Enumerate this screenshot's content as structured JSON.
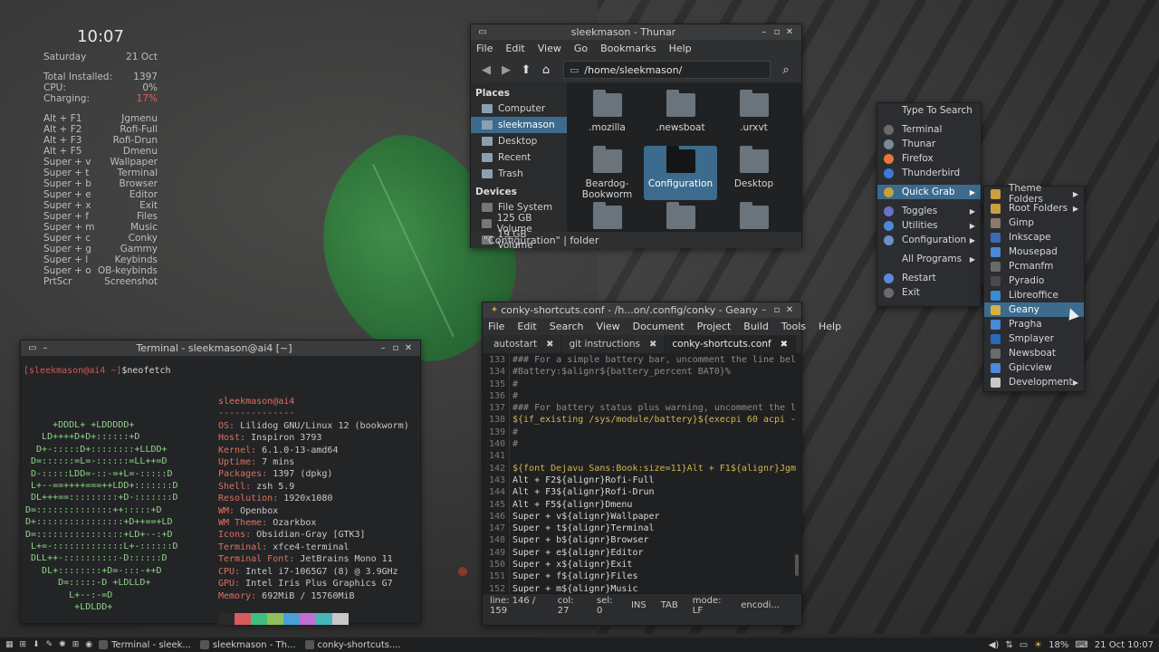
{
  "conky": {
    "time": "10:07",
    "day": "Saturday",
    "date": "21 Oct",
    "stats": [
      {
        "label": "Total Installed:",
        "value": "1397"
      },
      {
        "label": "CPU:",
        "value": "0%"
      },
      {
        "label": "Charging:",
        "value": "17%"
      }
    ],
    "shortcuts": [
      {
        "key": "Alt + F1",
        "action": "Jgmenu"
      },
      {
        "key": "Alt + F2",
        "action": "Rofi-Full"
      },
      {
        "key": "Alt + F3",
        "action": "Rofi-Drun"
      },
      {
        "key": "Alt + F5",
        "action": "Dmenu"
      },
      {
        "key": "Super + v",
        "action": "Wallpaper"
      },
      {
        "key": "Super + t",
        "action": "Terminal"
      },
      {
        "key": "Super + b",
        "action": "Browser"
      },
      {
        "key": "Super + e",
        "action": "Editor"
      },
      {
        "key": "Super + x",
        "action": "Exit"
      },
      {
        "key": "Super + f",
        "action": "Files"
      },
      {
        "key": "Super + m",
        "action": "Music"
      },
      {
        "key": "Super + c",
        "action": "Conky"
      },
      {
        "key": "Super + g",
        "action": "Gammy"
      },
      {
        "key": "Super + l",
        "action": "Keybinds"
      },
      {
        "key": "Super + o",
        "action": "OB-keybinds"
      },
      {
        "key": "PrtScr",
        "action": "Screenshot"
      }
    ]
  },
  "thunar": {
    "title": "sleekmason - Thunar",
    "menu": [
      "File",
      "Edit",
      "View",
      "Go",
      "Bookmarks",
      "Help"
    ],
    "path": "/home/sleekmason/",
    "places_label": "Places",
    "places": [
      "Computer",
      "sleekmason",
      "Desktop",
      "Recent",
      "Trash"
    ],
    "devices_label": "Devices",
    "devices": [
      "File System",
      "125 GB Volume",
      "19 GB Volume"
    ],
    "items": [
      ".mozilla",
      ".newsboat",
      ".urxvt",
      "Beardog-Bookworm",
      "Configuration",
      "Desktop",
      "",
      "",
      ""
    ],
    "status": "\"Configuration\"  |  folder"
  },
  "terminal": {
    "title": "Terminal - sleekmason@ai4 [~]",
    "prompt_user": "[sleekmason@ai4 ~]",
    "prompt_cmd": "$neofetch",
    "header": "sleekmason@ai4",
    "dashes": "--------------",
    "info": [
      {
        "k": "OS:",
        "v": "Lilidog GNU/Linux 12 (bookworm)"
      },
      {
        "k": "Host:",
        "v": "Inspiron 3793"
      },
      {
        "k": "Kernel:",
        "v": "6.1.0-13-amd64"
      },
      {
        "k": "Uptime:",
        "v": "7 mins"
      },
      {
        "k": "Packages:",
        "v": "1397 (dpkg)"
      },
      {
        "k": "Shell:",
        "v": "zsh 5.9"
      },
      {
        "k": "Resolution:",
        "v": "1920x1080"
      },
      {
        "k": "WM:",
        "v": "Openbox"
      },
      {
        "k": "WM Theme:",
        "v": "Ozarkbox"
      },
      {
        "k": "Icons:",
        "v": "Obsidian-Gray [GTK3]"
      },
      {
        "k": "Terminal:",
        "v": "xfce4-terminal"
      },
      {
        "k": "Terminal Font:",
        "v": "JetBrains Mono 11"
      },
      {
        "k": "CPU:",
        "v": "Intel i7-1065G7 (8) @ 3.9GHz"
      },
      {
        "k": "GPU:",
        "v": "Intel Iris Plus Graphics G7"
      },
      {
        "k": "Memory:",
        "v": "692MiB / 15760MiB"
      }
    ],
    "art": [
      "     +DDDL+ +LDDDDD+",
      "   LD++++D+D+::::::+D",
      "  D+-:::::D+::::::::+LLDD+",
      " D=::::::=L=-::::::=LL++=D",
      " D-:::::LDD=-::-=+L=-:::::D",
      " L+--==++++===++LDD+:::::::D",
      " DL+++==:::::::::+D-:::::::D",
      "D=::::::::::::::++:::::+D",
      "D+::::::::::::::::+D++==+LD",
      "D=::::::::::::::::+LD+--:+D",
      " L+=-:::::::::::::L+-::::::D",
      " DLL++-::::::::::-D::::::D",
      "   DL+::::::::+D=-:::-++D",
      "      D=:::::-D +LDLLD+",
      "        L+--:-=D",
      "         +LDLDD+"
    ],
    "swatch_colors": [
      "#2a2a2a",
      "#d85a5a",
      "#3fbf7f",
      "#8fbf5a",
      "#4a9fd8",
      "#c06fd0",
      "#49b6b6",
      "#c8c8c8"
    ]
  },
  "geany": {
    "title": "conky-shortcuts.conf - /h...on/.config/conky - Geany",
    "menu": [
      "File",
      "Edit",
      "Search",
      "View",
      "Document",
      "Project",
      "Build",
      "Tools",
      "Help"
    ],
    "tabs": [
      "autostart",
      "git instructions",
      "conky-shortcuts.conf"
    ],
    "lines": [
      {
        "n": "133",
        "t": "### For a simple battery bar, uncomment the line bel",
        "c": "c"
      },
      {
        "n": "134",
        "t": "#Battery:$alignr${battery_percent BAT0}%",
        "c": "c"
      },
      {
        "n": "135",
        "t": "#",
        "c": "c"
      },
      {
        "n": "136",
        "t": "#",
        "c": "c"
      },
      {
        "n": "137",
        "t": "### For battery status plus warning, uncomment the l",
        "c": "c"
      },
      {
        "n": "138",
        "t": "${if_existing /sys/module/battery}${execpi 60 acpi -",
        "c": "y"
      },
      {
        "n": "139",
        "t": "#",
        "c": "c"
      },
      {
        "n": "140",
        "t": "#",
        "c": "c"
      },
      {
        "n": "141",
        "t": "",
        "c": "w"
      },
      {
        "n": "142",
        "t": "${font Dejavu Sans:Book:size=11}Alt + F1${alignr}Jgm",
        "c": "y"
      },
      {
        "n": "143",
        "t": "Alt + F2${alignr}Rofi-Full",
        "c": "w"
      },
      {
        "n": "144",
        "t": "Alt + F3${alignr}Rofi-Drun",
        "c": "w"
      },
      {
        "n": "145",
        "t": "Alt + F5${alignr}Dmenu",
        "c": "w"
      },
      {
        "n": "146",
        "t": "Super + v${alignr}Wallpaper",
        "c": "w"
      },
      {
        "n": "147",
        "t": "Super + t${alignr}Terminal",
        "c": "w"
      },
      {
        "n": "148",
        "t": "Super + b${alignr}Browser",
        "c": "w"
      },
      {
        "n": "149",
        "t": "Super + e${alignr}Editor",
        "c": "w"
      },
      {
        "n": "150",
        "t": "Super + x${alignr}Exit",
        "c": "w"
      },
      {
        "n": "151",
        "t": "Super + f${alignr}Files",
        "c": "w"
      },
      {
        "n": "152",
        "t": "Super + m${alignr}Music",
        "c": "w"
      }
    ],
    "status": [
      "line: 146 / 159",
      "col: 27",
      "sel: 0",
      "INS",
      "TAB",
      "mode: LF",
      "encodi..."
    ]
  },
  "menu": {
    "main": [
      {
        "label": "Type To Search",
        "icon": "search-icon"
      },
      {
        "label": "",
        "sep": true
      },
      {
        "label": "Terminal",
        "icon": "terminal-icon"
      },
      {
        "label": "Thunar",
        "icon": "folder-icon"
      },
      {
        "label": "Firefox",
        "icon": "firefox-icon"
      },
      {
        "label": "Thunderbird",
        "icon": "mail-icon"
      },
      {
        "label": "",
        "sep": true
      },
      {
        "label": "Quick Grab",
        "icon": "grab-icon",
        "arrow": true,
        "sel": true
      },
      {
        "label": "",
        "sep": true
      },
      {
        "label": "Toggles",
        "icon": "toggle-icon",
        "arrow": true
      },
      {
        "label": "Utilities",
        "icon": "utilities-icon",
        "arrow": true
      },
      {
        "label": "Configuration",
        "icon": "config-icon",
        "arrow": true
      },
      {
        "label": "",
        "sep": true
      },
      {
        "label": "All Programs",
        "icon": "",
        "arrow": true
      },
      {
        "label": "",
        "sep": true
      },
      {
        "label": "Restart",
        "icon": "restart-icon"
      },
      {
        "label": "Exit",
        "icon": "exit-icon"
      }
    ],
    "sub": [
      {
        "label": "Theme Folders",
        "arrow": true
      },
      {
        "label": "Root Folders",
        "arrow": true
      },
      {
        "label": "Gimp"
      },
      {
        "label": "Inkscape"
      },
      {
        "label": "Mousepad"
      },
      {
        "label": "Pcmanfm"
      },
      {
        "label": "Pyradio"
      },
      {
        "label": "Libreoffice"
      },
      {
        "label": "Geany",
        "sel": true
      },
      {
        "label": "Pragha"
      },
      {
        "label": "Smplayer"
      },
      {
        "label": "Newsboat"
      },
      {
        "label": "Gpicview"
      },
      {
        "label": "Development",
        "arrow": true
      }
    ]
  },
  "taskbar": {
    "tasks": [
      "Terminal - sleek...",
      "sleekmason - Th...",
      "conky-shortcuts...."
    ],
    "battery": "18%",
    "datetime": "21 Oct 10:07"
  }
}
